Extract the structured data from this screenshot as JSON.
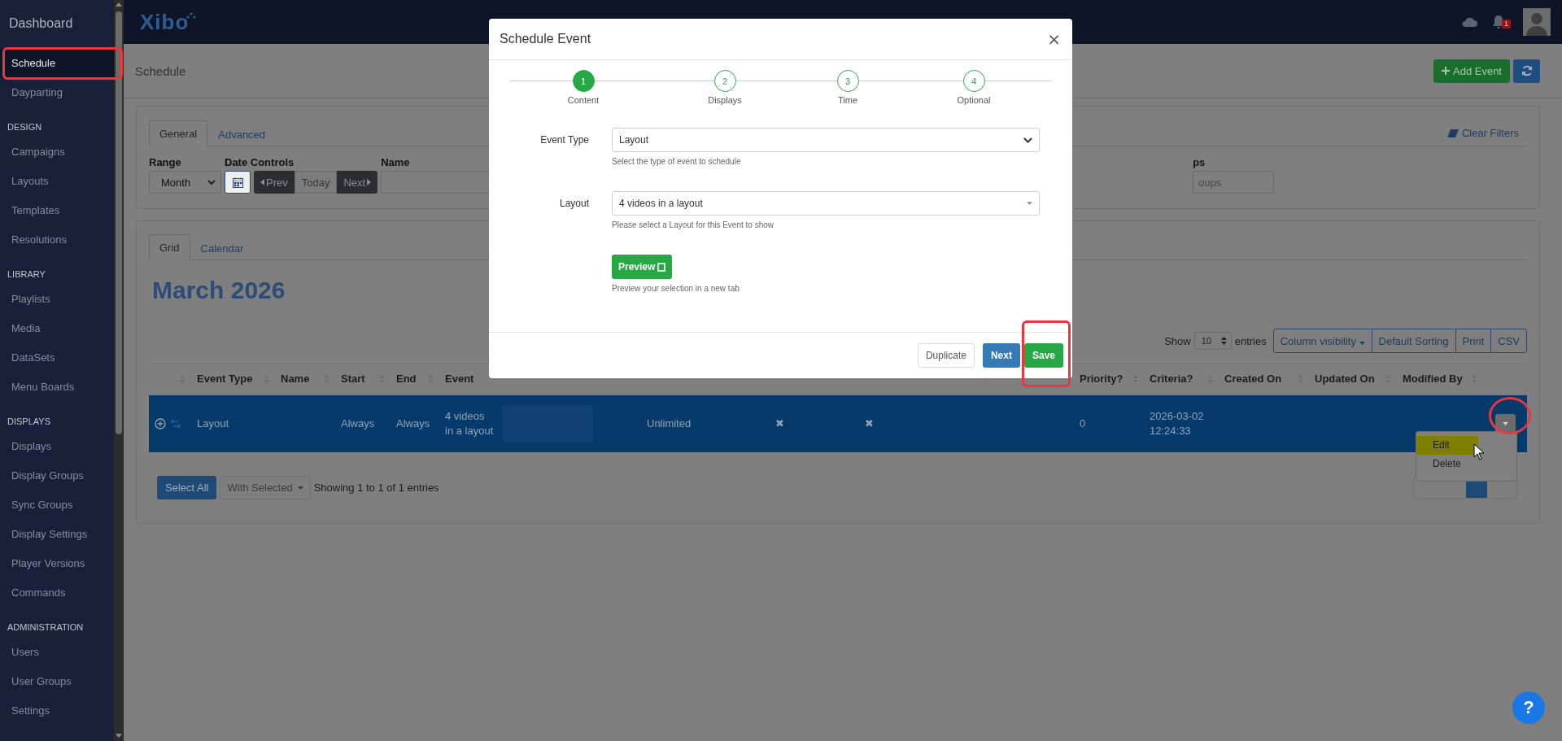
{
  "sidebar": {
    "title": "Dashboard",
    "groups": [
      {
        "items": [
          {
            "label": "Schedule",
            "selected": true
          },
          {
            "label": "Dayparting",
            "selected": false
          }
        ]
      },
      {
        "heading": "DESIGN",
        "items": [
          {
            "label": "Campaigns",
            "selected": false
          },
          {
            "label": "Layouts",
            "selected": false
          },
          {
            "label": "Templates",
            "selected": false
          },
          {
            "label": "Resolutions",
            "selected": false
          }
        ]
      },
      {
        "heading": "LIBRARY",
        "items": [
          {
            "label": "Playlists",
            "selected": false
          },
          {
            "label": "Media",
            "selected": false
          },
          {
            "label": "DataSets",
            "selected": false
          },
          {
            "label": "Menu Boards",
            "selected": false
          }
        ]
      },
      {
        "heading": "DISPLAYS",
        "items": [
          {
            "label": "Displays",
            "selected": false
          },
          {
            "label": "Display Groups",
            "selected": false
          },
          {
            "label": "Sync Groups",
            "selected": false
          },
          {
            "label": "Display Settings",
            "selected": false
          },
          {
            "label": "Player Versions",
            "selected": false
          },
          {
            "label": "Commands",
            "selected": false
          }
        ]
      },
      {
        "heading": "ADMINISTRATION",
        "items": [
          {
            "label": "Users",
            "selected": false
          },
          {
            "label": "User Groups",
            "selected": false
          },
          {
            "label": "Settings",
            "selected": false
          }
        ]
      }
    ]
  },
  "header": {
    "logo": "Xibo",
    "notification_count": "1"
  },
  "help_button": "?",
  "page": {
    "title": "Schedule",
    "add_button": "Add Event"
  },
  "filters": {
    "tabs": [
      {
        "label": "General",
        "selected": true
      },
      {
        "label": "Advanced",
        "selected": false
      }
    ],
    "clear_filters": "Clear Filters",
    "range": {
      "label": "Range",
      "value": "Month"
    },
    "date_controls": {
      "label": "Date Controls",
      "buttons": [
        "Prev",
        "Today",
        "Next"
      ]
    },
    "name": {
      "label": "Name"
    },
    "groups": {
      "label": "ps",
      "placeholder": "oups"
    }
  },
  "grid": {
    "tabs": [
      {
        "label": "Grid",
        "selected": true
      },
      {
        "label": "Calendar",
        "selected": false
      }
    ],
    "heading": "March 2026",
    "show_label": "Show",
    "page_length": "10",
    "entries_label": "entries",
    "buttons": [
      "Column visibility",
      "Default Sorting",
      "Print",
      "CSV"
    ],
    "columns": [
      {
        "sortable": true
      },
      {
        "label": "Event Type",
        "sortable": true
      },
      {
        "label": "Name",
        "sortable": true
      },
      {
        "label": "Start",
        "sortable": true
      },
      {
        "label": "End",
        "sortable": true
      },
      {
        "label": "Event",
        "sortable": false
      },
      {
        "sortable": false
      },
      {
        "sortable": false
      },
      {
        "sortable": false
      },
      {
        "sortable": false
      },
      {
        "label": "Priority?",
        "sortable": true
      },
      {
        "label": "Criteria?",
        "sortable": true
      },
      {
        "label": "Created On",
        "sortable": true
      },
      {
        "label": "Updated On",
        "sortable": true
      },
      {
        "label": "Modified By",
        "sortable": true
      },
      {
        "sortable": false
      }
    ],
    "rows": [
      {
        "selected": true,
        "cells": [
          {
            "kind": "expand"
          },
          {
            "text": "Layout"
          },
          {},
          {
            "text": "Always"
          },
          {
            "text": "Always"
          },
          {
            "text": "4 videos in a layout"
          },
          {
            "kind": "blurred"
          },
          {
            "text": "Unlimited"
          },
          {
            "text": "✖"
          },
          {
            "text": "✖"
          },
          {
            "text": "0"
          },
          {
            "text": "2026-03-02 12:24:33"
          },
          {},
          {},
          {},
          {
            "kind": "menu"
          }
        ]
      }
    ],
    "select_all": "Select All",
    "with_selected": "With Selected",
    "info": "Showing 1 to 1 of 1 entries",
    "row_menu": [
      {
        "label": "Edit",
        "selected": true
      },
      {
        "label": "Delete",
        "selected": false
      }
    ]
  },
  "modal": {
    "title": "Schedule Event",
    "close": "×",
    "steps": [
      {
        "number": "1",
        "label": "Content",
        "selected": true
      },
      {
        "number": "2",
        "label": "Displays",
        "selected": false
      },
      {
        "number": "3",
        "label": "Time",
        "selected": false
      },
      {
        "number": "4",
        "label": "Optional",
        "selected": false
      }
    ],
    "fields": [
      {
        "label": "Event Type",
        "value": "Layout",
        "help": "Select the type of event to schedule",
        "kind": "select"
      },
      {
        "label": "Layout",
        "value": "4 videos in a layout",
        "help": "Please select a Layout for this Event to show",
        "kind": "combo"
      }
    ],
    "preview": {
      "label": "Preview",
      "help": "Preview your selection in a new tab"
    },
    "buttons": [
      {
        "label": "Duplicate",
        "kind": "default"
      },
      {
        "label": "Next",
        "kind": "primary"
      },
      {
        "label": "Save",
        "kind": "success"
      }
    ]
  }
}
